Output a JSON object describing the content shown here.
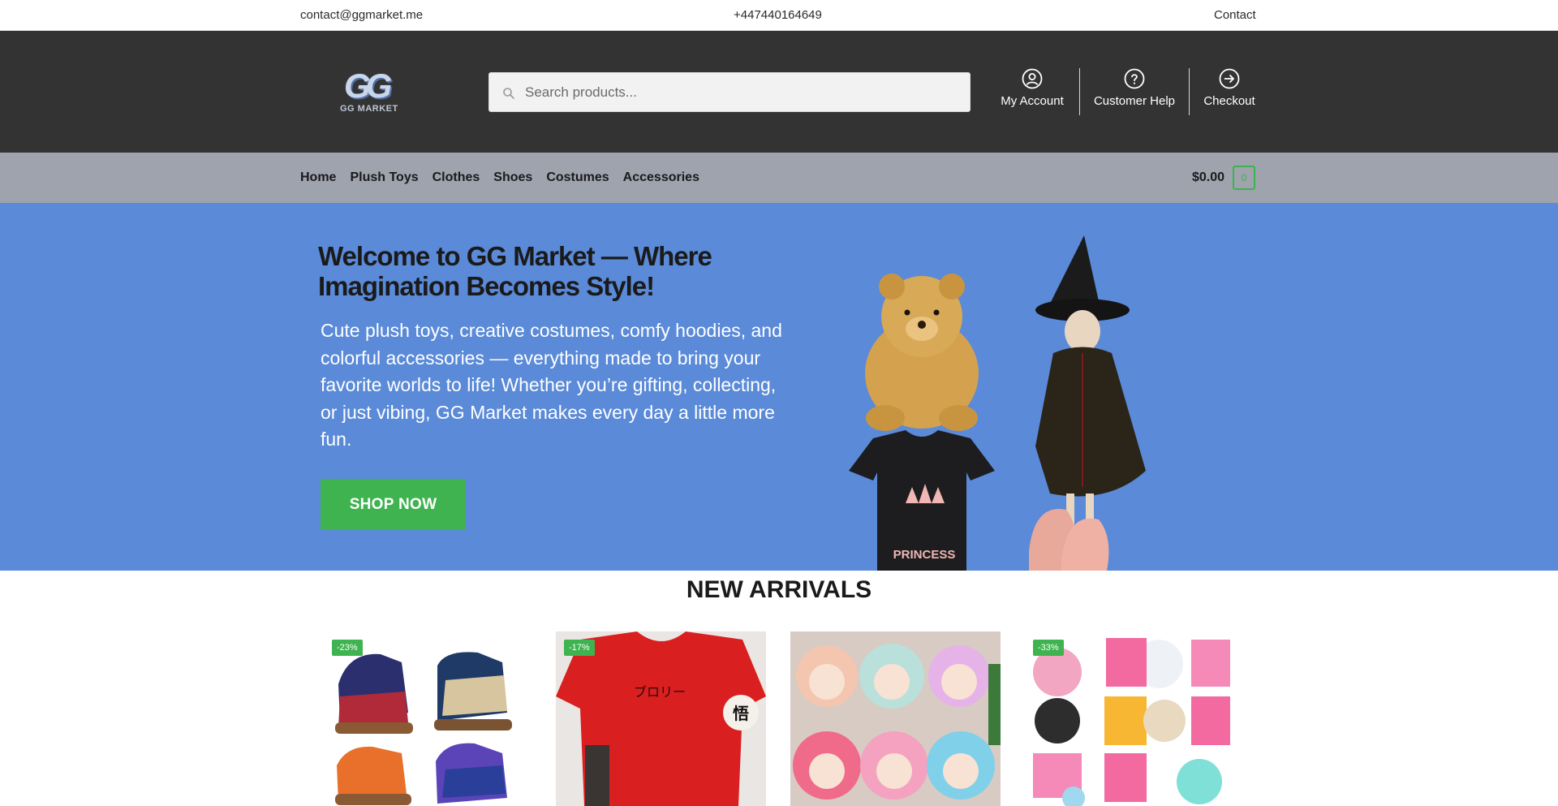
{
  "topbar": {
    "email": "contact@ggmarket.me",
    "phone": "+447440164649",
    "contact_label": "Contact"
  },
  "header": {
    "logo_text": "GG",
    "logo_subtext": "GG MARKET",
    "search_placeholder": "Search products...",
    "nav": [
      {
        "label": "My Account",
        "icon": "user-circle-icon"
      },
      {
        "label": "Customer Help",
        "icon": "help-circle-icon"
      },
      {
        "label": "Checkout",
        "icon": "arrow-right-circle-icon"
      }
    ]
  },
  "categories": [
    "Home",
    "Plush Toys",
    "Clothes",
    "Shoes",
    "Costumes",
    "Accessories"
  ],
  "cart": {
    "amount": "$0.00",
    "count": "0"
  },
  "hero": {
    "title": "Welcome to GG Market — Where Imagination Becomes Style!",
    "description": "Cute plush toys, creative costumes, comfy hoodies, and colorful accessories — everything made to bring your favorite worlds to life! Whether you’re gifting, collecting, or just vibing, GG Market makes every day a little more fun.",
    "cta_label": "SHOP NOW",
    "tshirt_text": "PRINCESS"
  },
  "new_arrivals": {
    "title": "NEW ARRIVALS",
    "products": [
      {
        "badge": "-23%",
        "image": "anime-sneakers"
      },
      {
        "badge": "-17%",
        "image": "red-tshirt",
        "print_text": "ブロリー"
      },
      {
        "badge": "",
        "image": "plush-dolls"
      },
      {
        "badge": "-33%",
        "image": "plush-blind-boxes"
      }
    ]
  },
  "colors": {
    "header_bg": "#333333",
    "catbar_bg": "#9ea3ae",
    "hero_bg": "#5a8ad8",
    "accent_green": "#3fb34f"
  }
}
